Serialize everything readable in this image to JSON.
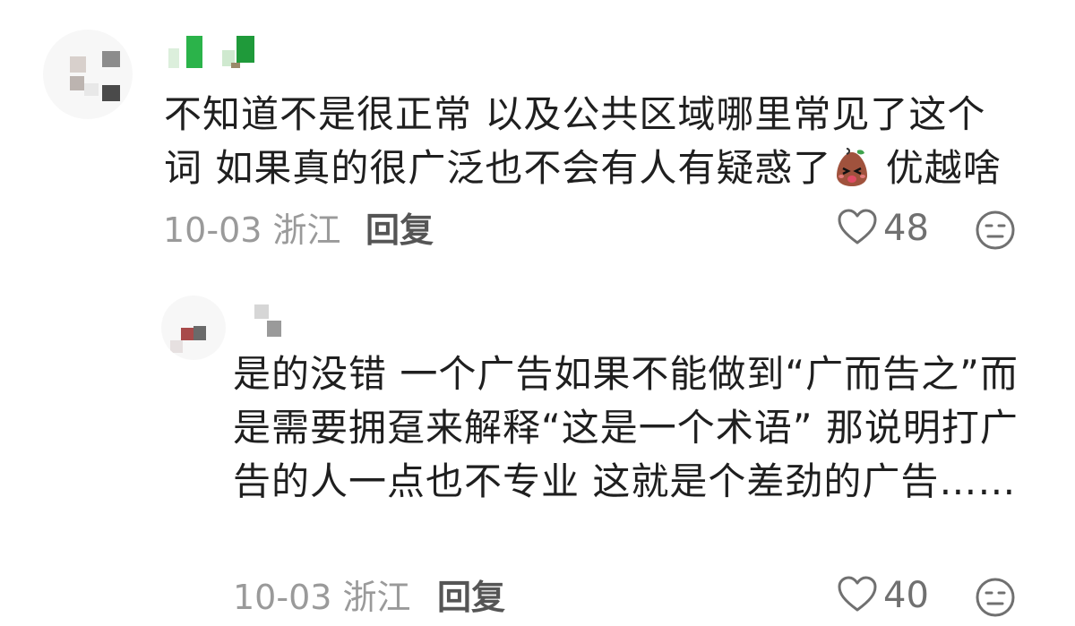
{
  "comments": [
    {
      "content_part1": "不知道不是很正常 以及公共区域哪里常见了这个词 如果真的很广泛也不会有人有疑惑了",
      "emoji_name": "confused-bag-emoji",
      "content_part2": " 优越啥",
      "date": "10-03",
      "location": "浙江",
      "reply_label": "回复",
      "likes": "48"
    },
    {
      "content": "是的没错 一个广告如果不能做到“广而告之”而是需要拥趸来解释“这是一个术语” 那说明打广告的人一点也不专业 这就是个差劲的广告……",
      "date": "10-03",
      "location": "浙江",
      "reply_label": "回复",
      "likes": "40"
    }
  ],
  "colors": {
    "text": "#1f1f1f",
    "meta": "#9a9a9a",
    "icon": "#707070"
  }
}
